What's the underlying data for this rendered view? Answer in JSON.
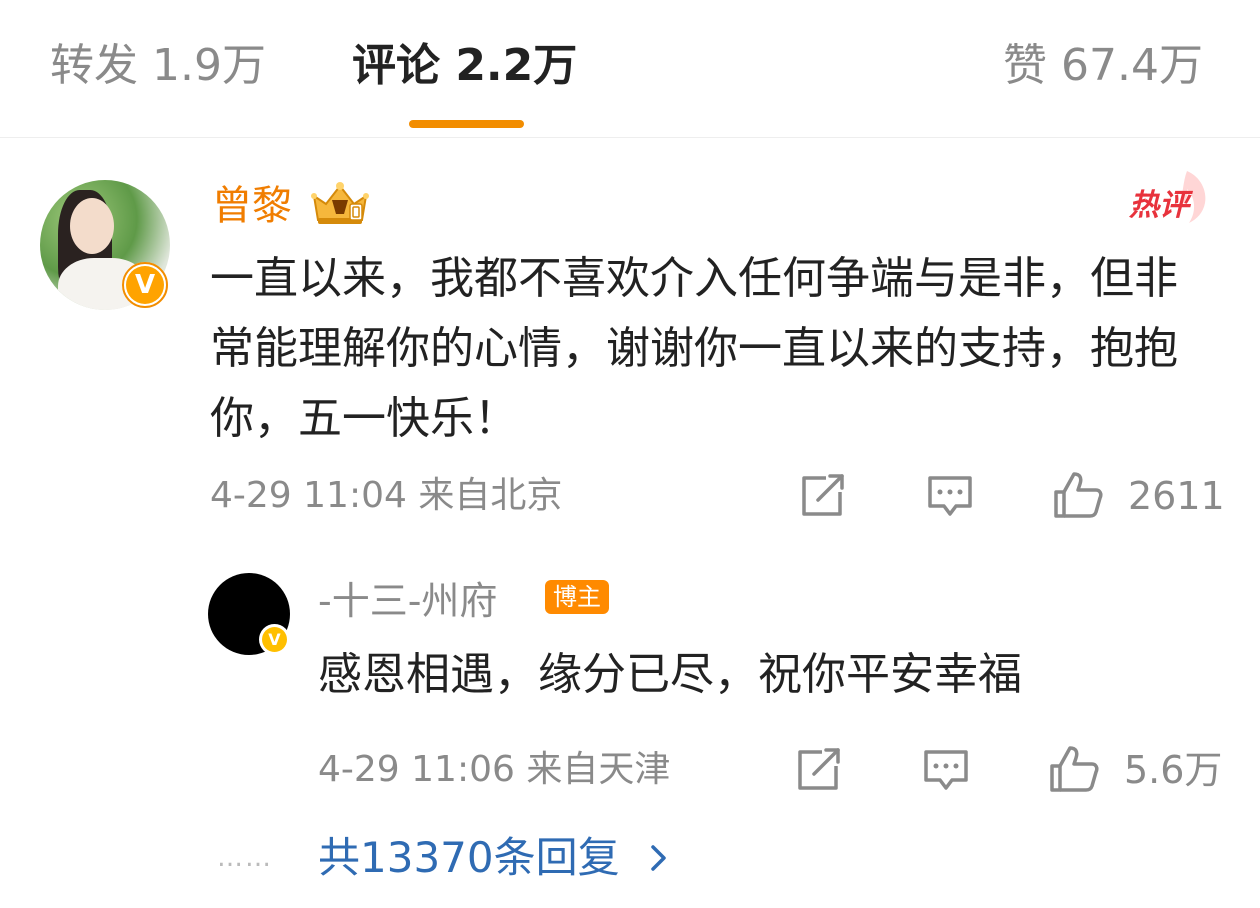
{
  "tabs": {
    "reposts": "转发 1.9万",
    "comments": "评论 2.2万",
    "likes": "赞 67.4万"
  },
  "comment": {
    "username": "曾黎",
    "hot_label": "热评",
    "text": "一直以来，我都不喜欢介入任何争端与是非，但非常能理解你的心情，谢谢你一直以来的支持，抱抱你，五一快乐！",
    "meta": "4-29 11:04 来自北京",
    "like_count": "2611",
    "verified_mark": "V"
  },
  "reply": {
    "username": "-十三-州府",
    "author_badge": "博主",
    "text": "感恩相遇，缘分已尽，祝你平安幸福",
    "meta": "4-29 11:06 来自天津",
    "like_count": "5.6万",
    "verified_mark": "V"
  },
  "more_replies": {
    "dots": "……",
    "label": "共13370条回复"
  },
  "colors": {
    "accent_orange": "#f28d00",
    "username_orange": "#f07d00",
    "link_blue": "#2f6bb3",
    "hot_red": "#e8323c",
    "gray_text": "#8a8a8a"
  },
  "icons": [
    "share-icon",
    "comment-icon",
    "like-icon",
    "chevron-right-icon",
    "crown-icon",
    "verified-icon"
  ]
}
